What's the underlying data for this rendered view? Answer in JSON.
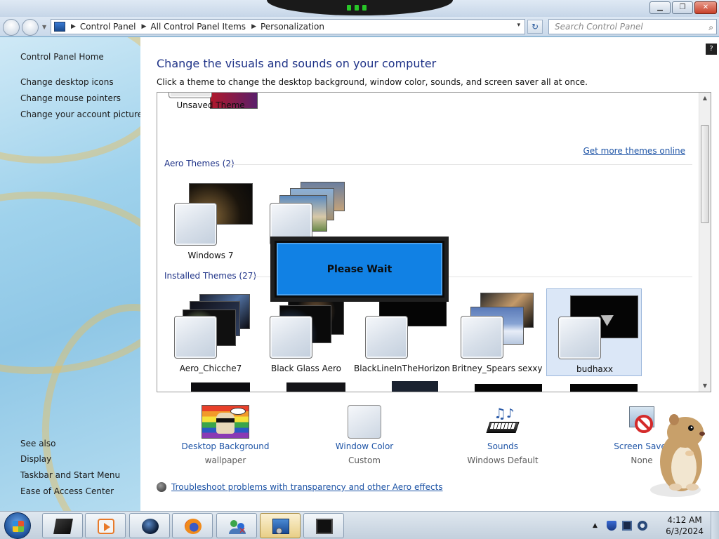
{
  "window": {
    "title": "",
    "buttons": {
      "minimize": "▁",
      "maximize": "❐",
      "close": "✕"
    }
  },
  "address": {
    "crumbs": [
      "Control Panel",
      "All Control Panel Items",
      "Personalization"
    ],
    "dropdown": "▾",
    "refresh": "↻"
  },
  "search": {
    "placeholder": "Search Control Panel",
    "icon": "magnifier-icon"
  },
  "sidebar": {
    "home": "Control Panel Home",
    "links": [
      "Change desktop icons",
      "Change mouse pointers",
      "Change your account picture"
    ],
    "see_also_label": "See also",
    "see_also": [
      "Display",
      "Taskbar and Start Menu",
      "Ease of Access Center"
    ]
  },
  "main": {
    "heading": "Change the visuals and sounds on your computer",
    "subheading": "Click a theme to change the desktop background, window color, sounds, and screen saver all at once.",
    "help_icon": "?",
    "my_themes": [
      {
        "label": "Unsaved Theme"
      }
    ],
    "get_more_link": "Get more themes online",
    "aero_group": "Aero Themes (2)",
    "aero_themes": [
      {
        "label": "Windows 7"
      },
      {
        "label": ""
      }
    ],
    "installed_group": "Installed Themes (27)",
    "installed_themes": [
      {
        "label": "Aero_Chicche7",
        "selected": false
      },
      {
        "label": "Black Glass Aero",
        "selected": false
      },
      {
        "label": "BlackLineInTheHorizon",
        "selected": false
      },
      {
        "label": "Britney_Spears sexxy",
        "selected": false
      },
      {
        "label": "budhaxx",
        "selected": true
      }
    ],
    "please_wait": "Please Wait"
  },
  "customizations": [
    {
      "link": "Desktop Background",
      "value": "wallpaper",
      "icon": "desktop-background-icon"
    },
    {
      "link": "Window Color",
      "value": "Custom",
      "icon": "window-color-icon"
    },
    {
      "link": "Sounds",
      "value": "Windows Default",
      "icon": "sounds-icon"
    },
    {
      "link": "Screen Saver",
      "value": "None",
      "icon": "screen-saver-icon"
    }
  ],
  "troubleshoot_link": "Troubleshoot problems with transparency and other Aero effects",
  "taskbar": {
    "pinned": [
      "window-app-icon",
      "media-player-icon",
      "globe-icon",
      "firefox-icon",
      "users-icon",
      "control-panel-icon",
      "monitor-icon"
    ],
    "active_index": 5,
    "clock": {
      "time": "4:12 AM",
      "date": "6/3/2024"
    },
    "tray_icons": [
      "show-hidden-icons-arrow",
      "shield-icon",
      "network-icon",
      "volume-icon"
    ]
  },
  "colors": {
    "link": "#1e54a6",
    "heading": "#1e3287",
    "selection": "#dbe7f7",
    "please_wait": "#1181e4"
  }
}
